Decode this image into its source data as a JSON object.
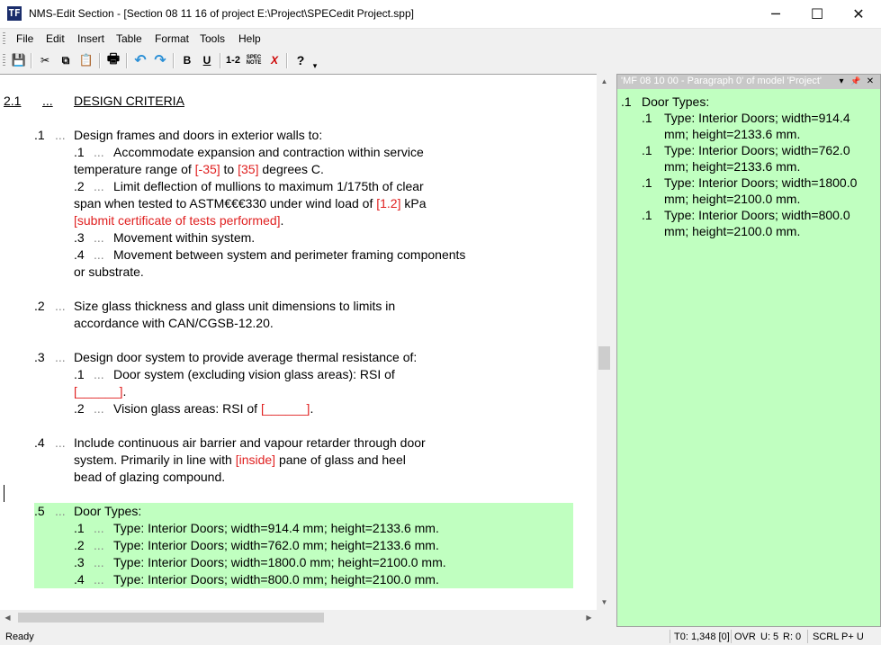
{
  "window": {
    "title": "NMS-Edit Section - [Section 08 11 16 of project E:\\Project\\SPECedit Project.spp]",
    "icon": "app-icon",
    "app_icon_text": "TF",
    "minimize_glyph": "─",
    "maximize_glyph": "☐",
    "close_glyph": "✕"
  },
  "menu": [
    "File",
    "Edit",
    "Insert",
    "Table",
    "Format",
    "Tools",
    "Help"
  ],
  "toolbar": {
    "save_icon": "💾",
    "cut_icon": "✂",
    "copy_icon": "⧉",
    "paste_icon": "📋",
    "print_icon": "🖶",
    "undo_icon": "↶",
    "redo_icon": "↷",
    "bold_label": "B",
    "underline_label": "U",
    "numbering_label": "1-2",
    "spec_note_label": "SPEC NOTE",
    "clear_format_label": "X",
    "help_icon": "?",
    "overflow_icon": "▾"
  },
  "document": {
    "heading_number": "2.1",
    "heading_dots": "...",
    "heading_title": "DESIGN CRITERIA",
    "dots": "...",
    "p1": {
      "num": ".1",
      "text": "Design frames and doors in exterior walls to:",
      "s1_num": ".1",
      "s1_a": "Accommodate expansion and contraction within service",
      "s1_b_pre": "temperature range of ",
      "s1_b_r1": "[-35]",
      "s1_b_mid": " to ",
      "s1_b_r2": "[35]",
      "s1_b_post": " degrees C.",
      "s2_num": ".2",
      "s2_a": "Limit deflection of mullions to maximum 1/175th of clear",
      "s2_b_pre": "span when tested to ASTM€€€330 under wind load of ",
      "s2_b_r1": "[1.2]",
      "s2_b_post": " kPa",
      "s2_c_r": "[submit certificate of tests performed]",
      "s2_c_post": ".",
      "s3_num": ".3",
      "s3_a": "Movement within system.",
      "s4_num": ".4",
      "s4_a": "Movement between system and perimeter framing components",
      "s4_b": "or substrate."
    },
    "p2": {
      "num": ".2",
      "a": "Size glass thickness and glass unit dimensions to limits in",
      "b": "accordance with CAN/CGSB-12.20."
    },
    "p3": {
      "num": ".3",
      "text": "Design door system to provide average thermal resistance of:",
      "s1_num": ".1",
      "s1_a": "Door system (excluding vision glass areas): RSI of",
      "s1_b_r": "[______]",
      "s1_b_post": ".",
      "s2_num": ".2",
      "s2_pre": "Vision glass areas: RSI of ",
      "s2_r": "[______]",
      "s2_post": "."
    },
    "p4": {
      "num": ".4",
      "a": "Include continuous air barrier and vapour retarder through door",
      "b_pre": "system. Primarily in line with ",
      "b_r": "[inside]",
      "b_post": " pane of glass and heel",
      "c": "bead of glazing compound."
    },
    "p5": {
      "num": ".5",
      "text": "Door Types:",
      "items": [
        {
          "num": ".1",
          "text": "Type: Interior Doors; width=914.4 mm; height=2133.6 mm."
        },
        {
          "num": ".2",
          "text": "Type: Interior Doors; width=762.0 mm; height=2133.6 mm."
        },
        {
          "num": ".3",
          "text": "Type: Interior Doors; width=1800.0 mm; height=2100.0 mm."
        },
        {
          "num": ".4",
          "text": "Type: Interior Doors; width=800.0 mm; height=2100.0 mm."
        }
      ]
    }
  },
  "panel": {
    "title": "'MF 08 10 00 - Paragraph 0' of model 'Project'",
    "dropdown_icon": "▾",
    "pin_icon": "📌",
    "close_icon": "✕",
    "heading_num": ".1",
    "heading": "Door Types:",
    "items": [
      {
        "num": ".1",
        "a": "Type: Interior Doors; width=914.4",
        "b": "mm; height=2133.6 mm."
      },
      {
        "num": ".1",
        "a": "Type: Interior Doors; width=762.0",
        "b": "mm; height=2133.6 mm."
      },
      {
        "num": ".1",
        "a": "Type: Interior Doors; width=1800.0",
        "b": "mm; height=2100.0 mm."
      },
      {
        "num": ".1",
        "a": "Type: Interior Doors; width=800.0",
        "b": "mm; height=2100.0 mm."
      }
    ]
  },
  "scroll": {
    "up": "▲",
    "down": "▼",
    "left": "◀",
    "right": "▶"
  },
  "status": {
    "left": "Ready",
    "position": "T0: 1,348 [0]",
    "mode": "OVR",
    "u": "U: 5",
    "r": "R: 0",
    "scroll_lock": "SCRL",
    "p_u": "P+ U"
  },
  "colors": {
    "highlight": "#c0ffc0",
    "spec_red": "#e02020",
    "panel_header": "#c8c8c8"
  }
}
